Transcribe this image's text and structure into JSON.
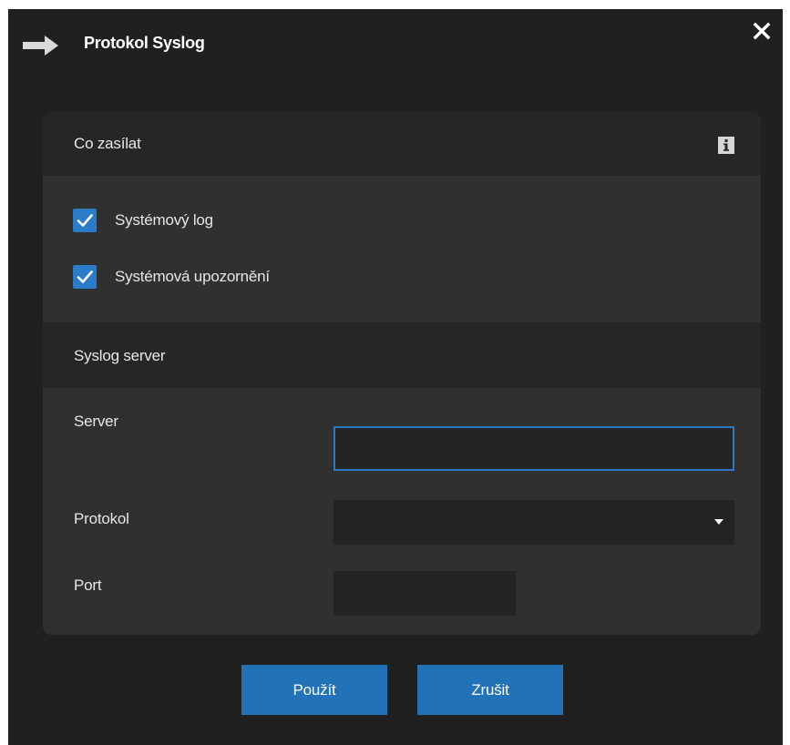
{
  "dialog": {
    "title": "Protokol Syslog",
    "icons": {
      "title": "arrow-right-icon",
      "close": "close-icon"
    }
  },
  "what_to_send": {
    "title": "Co zasílat",
    "info_icon": "info-icon",
    "options": [
      {
        "label": "Systémový log",
        "checked": true
      },
      {
        "label": "Systémová upozornění",
        "checked": true
      }
    ]
  },
  "syslog_server": {
    "title": "Syslog server",
    "server": {
      "label": "Server",
      "value": "",
      "placeholder": ""
    },
    "protocol": {
      "label": "Protokol",
      "value": ""
    },
    "port": {
      "label": "Port",
      "value": "",
      "placeholder": ""
    }
  },
  "buttons": {
    "apply": "Použít",
    "cancel": "Zrušit"
  },
  "colors": {
    "accent": "#2272b8",
    "checkbox": "#2a7bc8",
    "focus_border": "#2c78c2",
    "dialog_bg": "#202020",
    "panel_bg": "#303030",
    "header_bg": "#262626",
    "input_bg": "#242424"
  }
}
